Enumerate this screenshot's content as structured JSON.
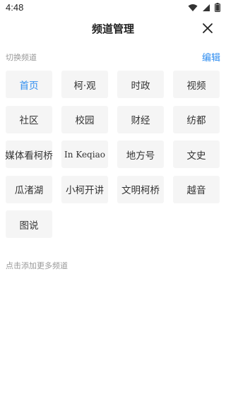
{
  "status": {
    "time": "4:48"
  },
  "header": {
    "title": "频道管理"
  },
  "section": {
    "label": "切换频道",
    "edit": "编辑"
  },
  "channels": [
    {
      "label": "首页",
      "active": true
    },
    {
      "label": "柯·观"
    },
    {
      "label": "时政"
    },
    {
      "label": "视频"
    },
    {
      "label": "社区"
    },
    {
      "label": "校园"
    },
    {
      "label": "财经"
    },
    {
      "label": "纺都"
    },
    {
      "label": "媒体看柯桥"
    },
    {
      "label": "In Keqiao"
    },
    {
      "label": "地方号"
    },
    {
      "label": "文史"
    },
    {
      "label": "瓜渚湖"
    },
    {
      "label": "小柯开讲"
    },
    {
      "label": "文明柯桥"
    },
    {
      "label": "越音"
    },
    {
      "label": "图说"
    }
  ],
  "add_section": {
    "label": "点击添加更多频道"
  },
  "colors": {
    "accent": "#2d8cf0",
    "chip_bg": "#f5f5f5",
    "muted": "#999999"
  },
  "icons": [
    "wifi-icon",
    "signal-icon",
    "battery-icon",
    "close-icon"
  ]
}
